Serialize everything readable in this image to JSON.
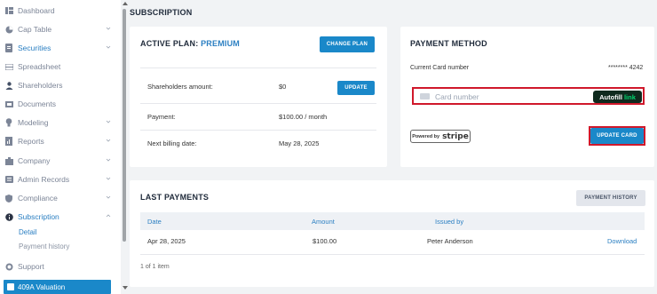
{
  "sidebar": {
    "items": [
      {
        "label": "Dashboard",
        "icon": "dashboard-icon",
        "chevron": false
      },
      {
        "label": "Cap Table",
        "icon": "pie-chart-icon",
        "chevron": true
      },
      {
        "label": "Securities",
        "icon": "document-icon",
        "chevron": true
      },
      {
        "label": "Spreadsheet",
        "icon": "spreadsheet-icon",
        "chevron": false
      },
      {
        "label": "Shareholders",
        "icon": "person-icon",
        "chevron": false
      },
      {
        "label": "Documents",
        "icon": "folder-icon",
        "chevron": false
      },
      {
        "label": "Modeling",
        "icon": "lightbulb-icon",
        "chevron": true
      },
      {
        "label": "Reports",
        "icon": "report-icon",
        "chevron": true
      },
      {
        "label": "Company",
        "icon": "building-icon",
        "chevron": true
      },
      {
        "label": "Admin Records",
        "icon": "records-icon",
        "chevron": true
      },
      {
        "label": "Compliance",
        "icon": "shield-icon",
        "chevron": true
      },
      {
        "label": "Subscription",
        "icon": "info-icon",
        "chevron": true
      }
    ],
    "sub_items": {
      "detail": "Detail",
      "payment_history": "Payment history"
    },
    "support": "Support",
    "valuation": "409A Valuation"
  },
  "page": {
    "title": "SUBSCRIPTION"
  },
  "plan": {
    "heading": "ACTIVE PLAN:",
    "name": "PREMIUM",
    "change_button": "CHANGE PLAN",
    "shareholders_label": "Shareholders amount:",
    "shareholders_value": "$0",
    "update_button": "UPDATE",
    "payment_label": "Payment:",
    "payment_value": "$100.00 / month",
    "billing_label": "Next billing date:",
    "billing_value": "May 28, 2025"
  },
  "payment_method": {
    "heading": "PAYMENT METHOD",
    "current_label": "Current Card number",
    "current_value": "******** 4242",
    "card_placeholder": "Card number",
    "autofill_text": "Autofill",
    "autofill_link": "link",
    "powered_by": "Powered by",
    "stripe": "stripe",
    "update_card_button": "UPDATE CARD"
  },
  "last_payments": {
    "heading": "LAST PAYMENTS",
    "history_button": "PAYMENT HISTORY",
    "columns": [
      "Date",
      "Amount",
      "Issued by"
    ],
    "rows": [
      {
        "date": "Apr 28, 2025",
        "amount": "$100.00",
        "issued_by": "Peter Anderson",
        "action": "Download"
      }
    ],
    "footer": "1 of 1 item"
  },
  "colors": {
    "accent": "#1a88c9",
    "link": "#2b7fc2",
    "highlight": "#d0182b"
  }
}
